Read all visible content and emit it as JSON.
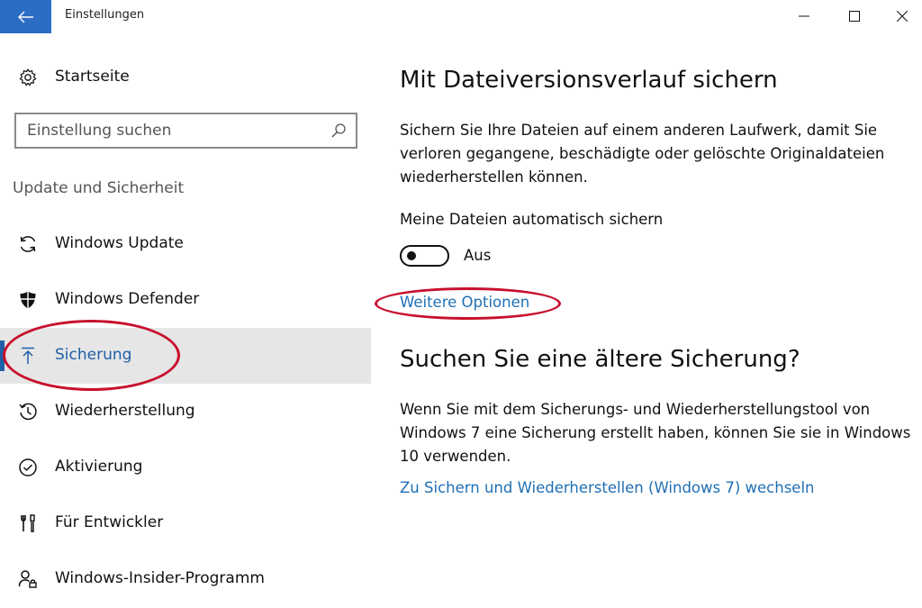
{
  "window": {
    "title": "Einstellungen",
    "controls": [
      "minimize-icon",
      "maximize-icon",
      "close-icon"
    ]
  },
  "sidebar": {
    "home_label": "Startseite",
    "search_placeholder": "Einstellung suchen",
    "section_title": "Update und Sicherheit",
    "items": [
      {
        "label": "Windows Update",
        "icon": "sync-icon",
        "selected": false
      },
      {
        "label": "Windows Defender",
        "icon": "shield-icon",
        "selected": false
      },
      {
        "label": "Sicherung",
        "icon": "upload-arrow-icon",
        "selected": true
      },
      {
        "label": "Wiederherstellung",
        "icon": "history-icon",
        "selected": false
      },
      {
        "label": "Aktivierung",
        "icon": "check-circle-icon",
        "selected": false
      },
      {
        "label": "Für Entwickler",
        "icon": "tools-icon",
        "selected": false
      },
      {
        "label": "Windows-Insider-Programm",
        "icon": "insider-user-icon",
        "selected": false
      }
    ]
  },
  "main": {
    "backup_heading": "Mit Dateiversionsverlauf sichern",
    "backup_description": "Sichern Sie Ihre Dateien auf einem anderen Laufwerk, damit Sie verloren gegangene, beschädigte oder gelöschte Originaldateien wiederherstellen können.",
    "auto_backup_label": "Meine Dateien automatisch sichern",
    "toggle_state": "Aus",
    "more_options_link": "Weitere Optionen",
    "older_backup_heading": "Suchen Sie eine ältere Sicherung?",
    "older_backup_description": "Wenn Sie mit dem Sicherungs- und Wiederherstellungstool von Windows 7 eine Sicherung erstellt haben, können Sie sie in Windows 10 verwenden.",
    "win7_link": "Zu Sichern und Wiederherstellen (Windows 7) wechseln"
  },
  "colors": {
    "accent": "#2b6cc4",
    "link": "#1f6fb5",
    "selected_bg": "#e6e6e6",
    "annotation": "#c8102e"
  }
}
